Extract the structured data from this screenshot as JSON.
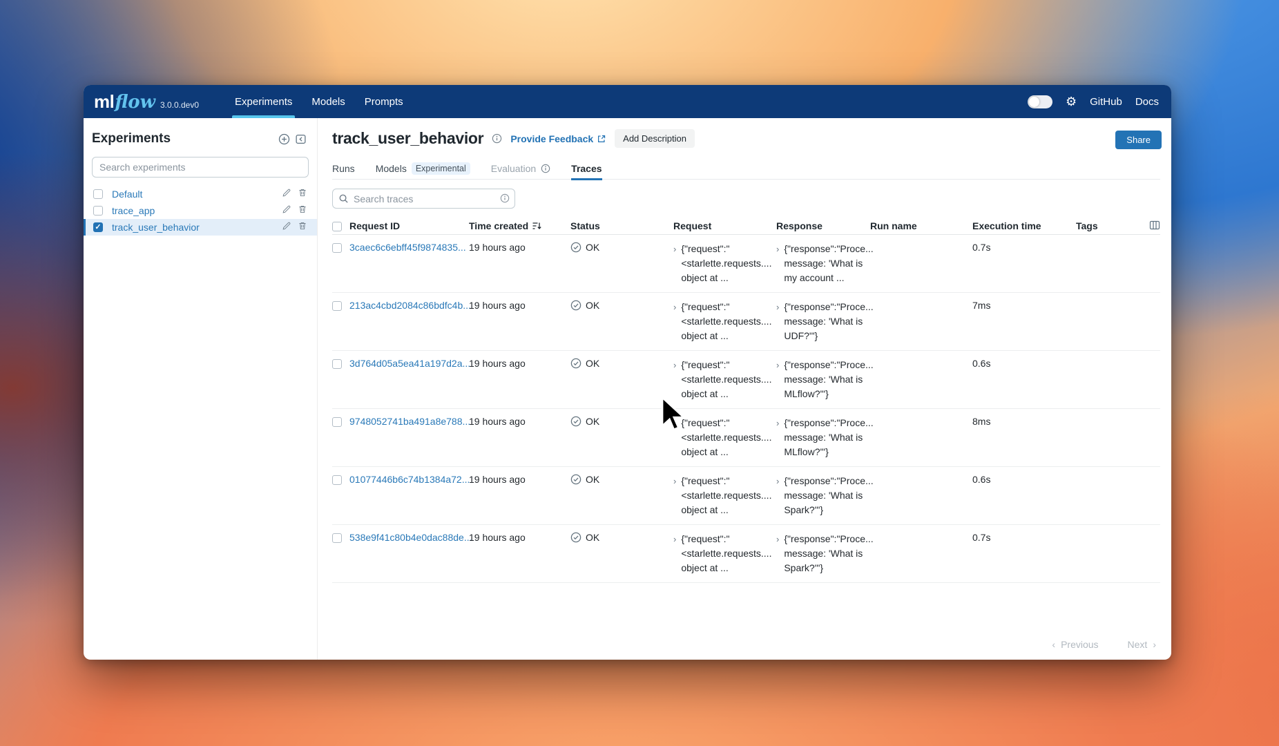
{
  "colors": {
    "navbar_bg": "#0d3a78",
    "brand_flow_blue": "#63c3ee",
    "nav_active_underline": "#56c5ec",
    "link_blue": "#2a79b8",
    "accent_blue": "#2272b4",
    "share_button_bg": "#2373b5",
    "selected_row_bg": "#e3eef9",
    "status_icon_gray": "#64737e"
  },
  "navbar": {
    "logo_ml": "ml",
    "logo_flow": "flow",
    "version": "3.0.0.dev0",
    "items": [
      {
        "label": "Experiments"
      },
      {
        "label": "Models"
      },
      {
        "label": "Prompts"
      }
    ],
    "right": {
      "github": "GitHub",
      "docs": "Docs"
    }
  },
  "sidebar": {
    "title": "Experiments",
    "search_placeholder": "Search experiments",
    "items": [
      {
        "name": "Default"
      },
      {
        "name": "trace_app"
      },
      {
        "name": "track_user_behavior"
      }
    ]
  },
  "main": {
    "title": "track_user_behavior",
    "feedback_link": "Provide Feedback",
    "add_description": "Add Description",
    "share": "Share",
    "tabs": [
      {
        "label": "Runs"
      },
      {
        "label": "Models",
        "badge": "Experimental"
      },
      {
        "label": "Evaluation"
      },
      {
        "label": "Traces"
      }
    ],
    "search_placeholder": "Search traces",
    "table": {
      "columns": [
        "Request ID",
        "Time created",
        "Status",
        "Request",
        "Response",
        "Run name",
        "Execution time",
        "Tags"
      ],
      "rows": [
        {
          "request_id": "3caec6c6ebff45f9874835...",
          "time": "19 hours ago",
          "status": "OK",
          "request_lines": [
            "{\"request\":\"",
            "<starlette.requests....",
            "object at ..."
          ],
          "response_lines": [
            "{\"response\":\"Proce...",
            "message: 'What is",
            "my account ..."
          ],
          "run_name": "",
          "execution_time": "0.7s",
          "tags": ""
        },
        {
          "request_id": "213ac4cbd2084c86bdfc4b...",
          "time": "19 hours ago",
          "status": "OK",
          "request_lines": [
            "{\"request\":\"",
            "<starlette.requests....",
            "object at ..."
          ],
          "response_lines": [
            "{\"response\":\"Proce...",
            "message: 'What is",
            "UDF?'\"}"
          ],
          "run_name": "",
          "execution_time": "7ms",
          "tags": ""
        },
        {
          "request_id": "3d764d05a5ea41a197d2a...",
          "time": "19 hours ago",
          "status": "OK",
          "request_lines": [
            "{\"request\":\"",
            "<starlette.requests....",
            "object at ..."
          ],
          "response_lines": [
            "{\"response\":\"Proce...",
            "message: 'What is",
            "MLflow?'\"}"
          ],
          "run_name": "",
          "execution_time": "0.6s",
          "tags": ""
        },
        {
          "request_id": "9748052741ba491a8e788...",
          "time": "19 hours ago",
          "status": "OK",
          "request_lines": [
            "{\"request\":\"",
            "<starlette.requests....",
            "object at ..."
          ],
          "response_lines": [
            "{\"response\":\"Proce...",
            "message: 'What is",
            "MLflow?'\"}"
          ],
          "run_name": "",
          "execution_time": "8ms",
          "tags": ""
        },
        {
          "request_id": "01077446b6c74b1384a72...",
          "time": "19 hours ago",
          "status": "OK",
          "request_lines": [
            "{\"request\":\"",
            "<starlette.requests....",
            "object at ..."
          ],
          "response_lines": [
            "{\"response\":\"Proce...",
            "message: 'What is",
            "Spark?'\"}"
          ],
          "run_name": "",
          "execution_time": "0.6s",
          "tags": ""
        },
        {
          "request_id": "538e9f41c80b4e0dac88de...",
          "time": "19 hours ago",
          "status": "OK",
          "request_lines": [
            "{\"request\":\"",
            "<starlette.requests....",
            "object at ..."
          ],
          "response_lines": [
            "{\"response\":\"Proce...",
            "message: 'What is",
            "Spark?'\"}"
          ],
          "run_name": "",
          "execution_time": "0.7s",
          "tags": ""
        }
      ]
    },
    "pagination": {
      "previous": "Previous",
      "next": "Next"
    }
  }
}
